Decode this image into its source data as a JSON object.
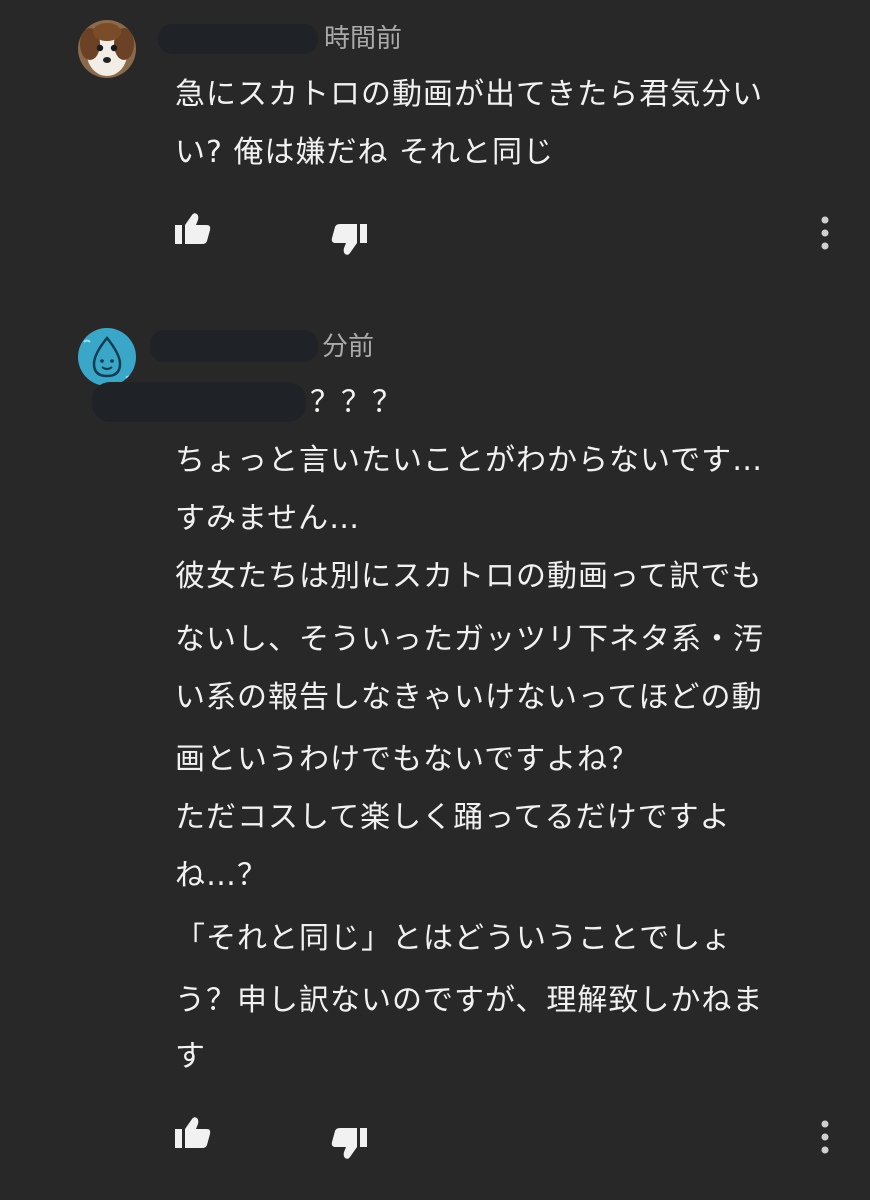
{
  "comments": [
    {
      "timestamp": "時間前",
      "avatar_icon": "dog-avatar-icon",
      "lines": [
        "急にスカトロの動画が出てきたら君気分い",
        "い? 俺は嫌だね  それと同じ"
      ],
      "actions": [
        "thumbs-up-icon",
        "thumbs-down-icon",
        "more-vertical-icon"
      ]
    },
    {
      "timestamp": "分前",
      "avatar_icon": "water-drop-avatar-icon",
      "reply_suffix": "？？？",
      "lines": [
        "ちょっと言いたいことがわからないです…",
        "すみません…",
        "彼女たちは別にスカトロの動画って訳でも",
        "ないし、そういったガッツリ下ネタ系・汚",
        "い系の報告しなきゃいけないってほどの動",
        "画というわけでもないですよね？",
        "ただコスして楽しく踊ってるだけですよ",
        "ね…？",
        "「それと同じ」とはどういうことでしょ",
        "う？申し訳ないのですが、理解致しかねま",
        "す"
      ],
      "actions": [
        "thumbs-up-icon",
        "thumbs-down-icon",
        "more-vertical-icon"
      ]
    }
  ],
  "colors": {
    "background": "#282828",
    "text": "#f1f1f1",
    "meta": "#aaaaaa",
    "redaction": "#1f2226",
    "avatar2_bg": "#3aa7c9"
  }
}
